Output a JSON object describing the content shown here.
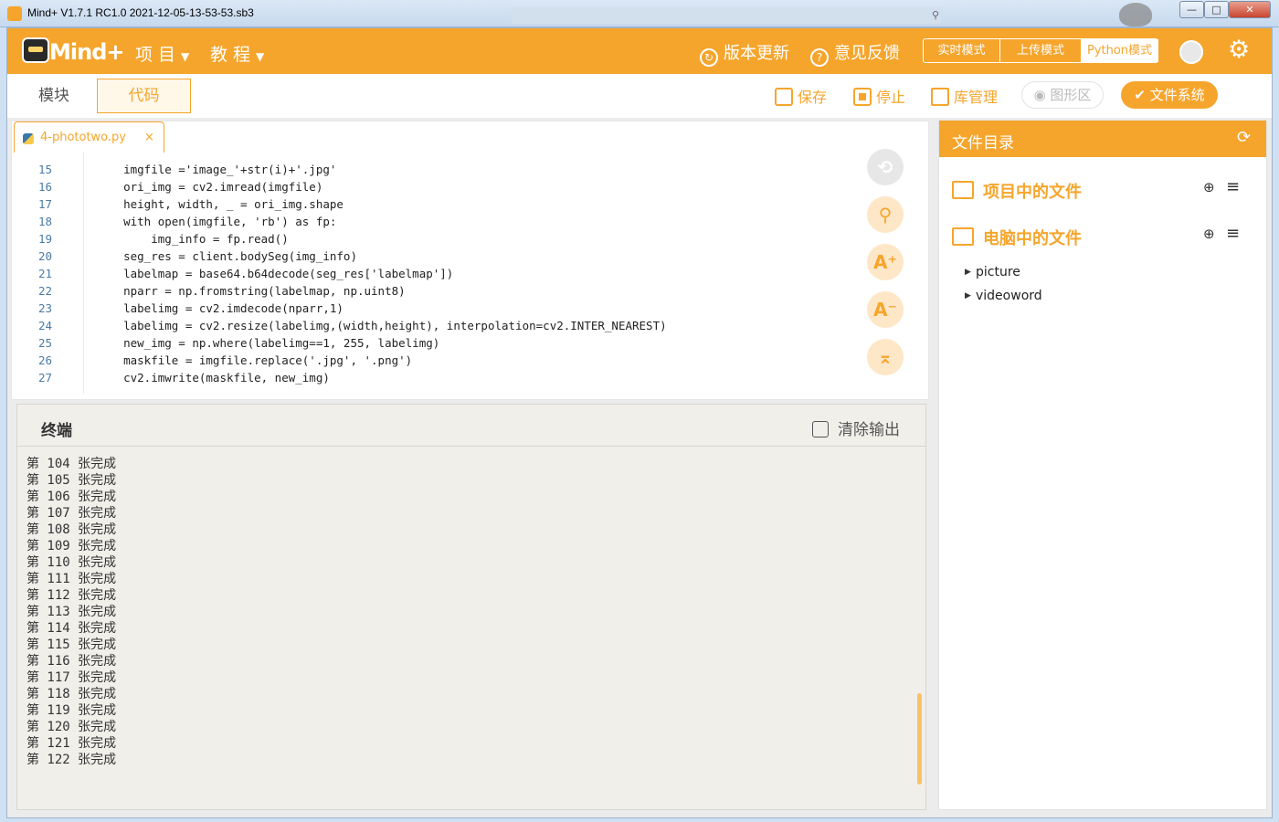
{
  "window": {
    "title": "Mind+ V1.7.1 RC1.0   2021-12-05-13-53-53.sb3",
    "min": "—",
    "max": "□",
    "close": "✕"
  },
  "header": {
    "menu_project": "项 目",
    "menu_tutorial": "教 程",
    "update": "版本更新",
    "feedback": "意见反馈",
    "modes": [
      "实时模式",
      "上传模式",
      "Python模式"
    ],
    "brand_color": "#f6a52c"
  },
  "toolbar": {
    "tab_blocks": "模块",
    "tab_code": "代码",
    "save": "保存",
    "stop": "停止",
    "library": "库管理",
    "graphics": "图形区",
    "filesystem": "文件系统"
  },
  "editor": {
    "file_name": "4-phototwo.py",
    "close": "×",
    "lines": [
      {
        "n": "15",
        "code": "    imgfile ='image_'+str(i)+'.jpg'"
      },
      {
        "n": "16",
        "code": "    ori_img = cv2.imread(imgfile)"
      },
      {
        "n": "17",
        "code": "    height, width, _ = ori_img.shape"
      },
      {
        "n": "18",
        "code": "    with open(imgfile, 'rb') as fp:"
      },
      {
        "n": "19",
        "code": "        img_info = fp.read()"
      },
      {
        "n": "20",
        "code": "    seg_res = client.bodySeg(img_info)"
      },
      {
        "n": "21",
        "code": "    labelmap = base64.b64decode(seg_res['labelmap'])"
      },
      {
        "n": "22",
        "code": "    nparr = np.fromstring(labelmap, np.uint8)"
      },
      {
        "n": "23",
        "code": "    labelimg = cv2.imdecode(nparr,1)"
      },
      {
        "n": "24",
        "code": "    labelimg = cv2.resize(labelimg,(width,height), interpolation=cv2.INTER_NEAREST)"
      },
      {
        "n": "25",
        "code": "    new_img = np.where(labelimg==1, 255, labelimg)"
      },
      {
        "n": "26",
        "code": "    maskfile = imgfile.replace('.jpg', '.png')"
      },
      {
        "n": "27",
        "code": "    cv2.imwrite(maskfile, new_img)"
      }
    ]
  },
  "terminal": {
    "title": "终端",
    "clear": "清除输出",
    "lines": [
      "第 104 张完成",
      "第 105 张完成",
      "第 106 张完成",
      "第 107 张完成",
      "第 108 张完成",
      "第 109 张完成",
      "第 110 张完成",
      "第 111 张完成",
      "第 112 张完成",
      "第 113 张完成",
      "第 114 张完成",
      "第 115 张完成",
      "第 116 张完成",
      "第 117 张完成",
      "第 118 张完成",
      "第 119 张完成",
      "第 120 张完成",
      "第 121 张完成",
      "第 122 张完成"
    ]
  },
  "files": {
    "title": "文件目录",
    "project_files": "项目中的文件",
    "computer_files": "电脑中的文件",
    "tree": [
      "picture",
      "videoword"
    ]
  }
}
